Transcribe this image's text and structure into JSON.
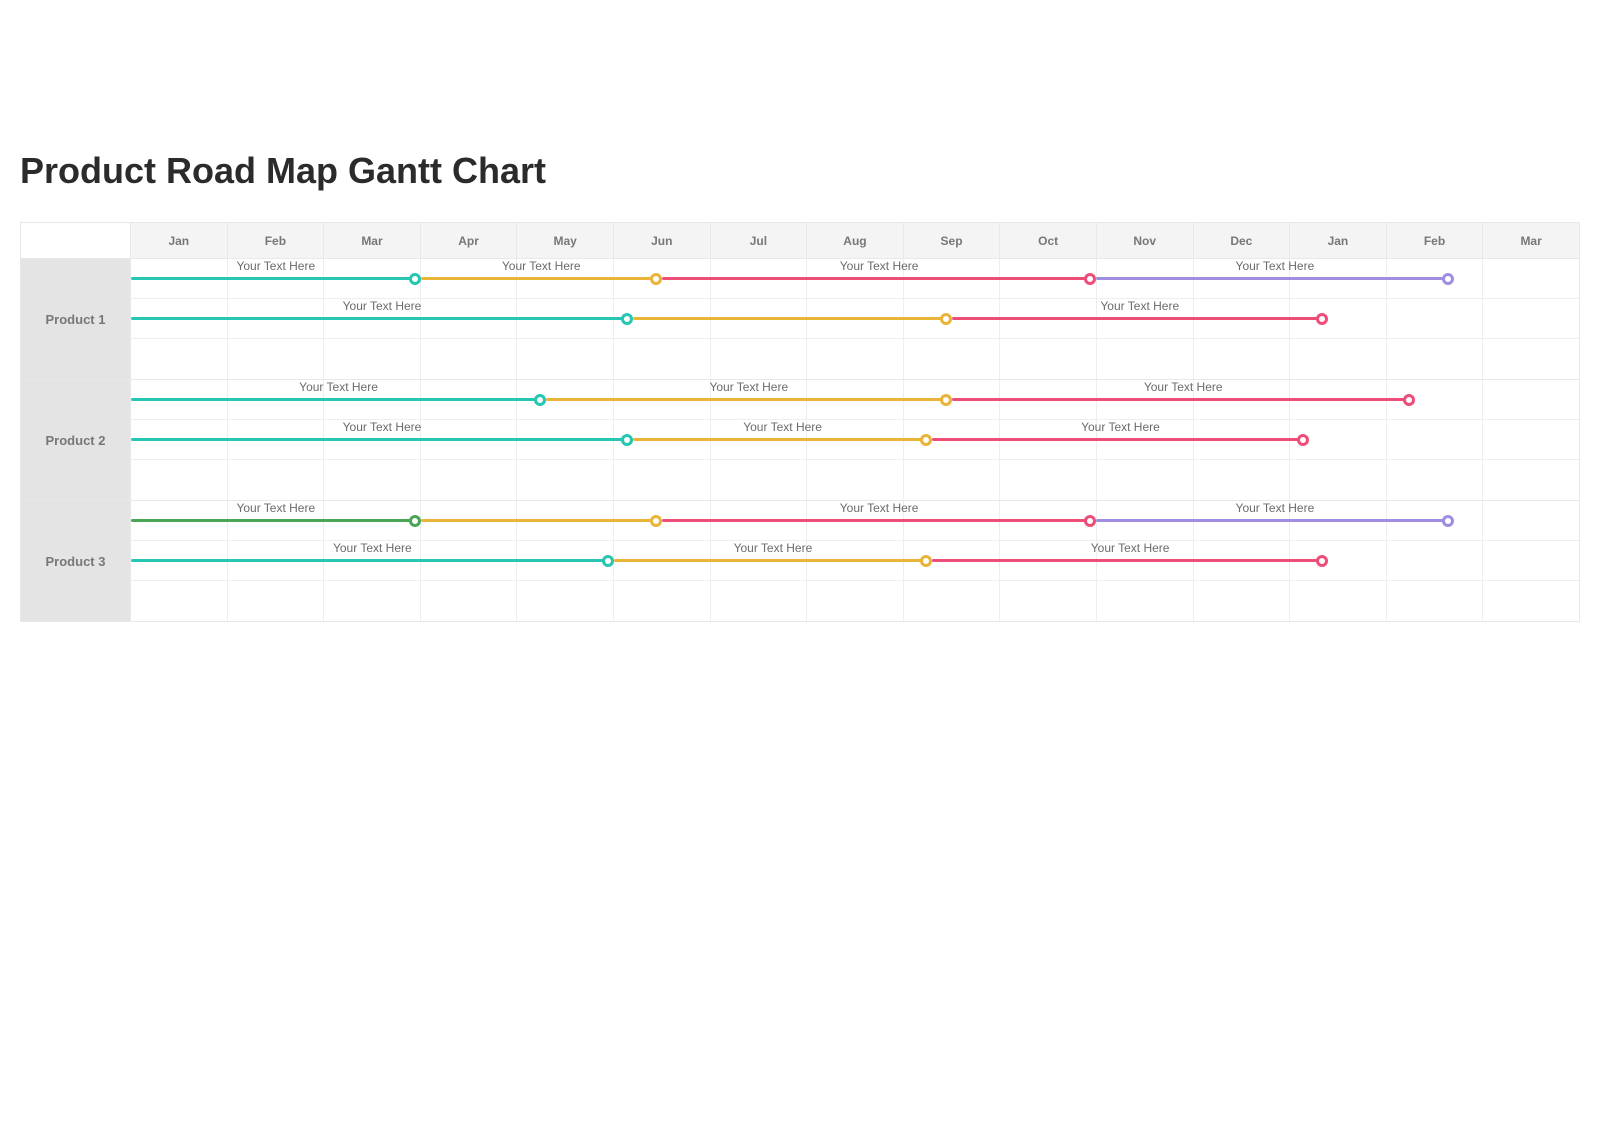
{
  "title": "Product Road Map Gantt Chart",
  "months": [
    "Jan",
    "Feb",
    "Mar",
    "Apr",
    "May",
    "Jun",
    "Jul",
    "Aug",
    "Sep",
    "Oct",
    "Nov",
    "Dec",
    "Jan",
    "Feb",
    "Mar"
  ],
  "products": [
    {
      "label": "Product 1"
    },
    {
      "label": "Product 2"
    },
    {
      "label": "Product 3"
    }
  ],
  "colors": {
    "teal": "#26c6b3",
    "green": "#4aa657",
    "amber": "#e9b438",
    "pink": "#ee4d78",
    "violet": "#a18de0"
  },
  "placeholder": "Your Text Here",
  "chart_data": {
    "type": "gantt-timeline",
    "time_axis": {
      "unit": "month",
      "labels": [
        "Jan",
        "Feb",
        "Mar",
        "Apr",
        "May",
        "Jun",
        "Jul",
        "Aug",
        "Sep",
        "Oct",
        "Nov",
        "Dec",
        "Jan",
        "Feb",
        "Mar"
      ],
      "n_cols": 15
    },
    "rows": [
      {
        "product": "Product 1",
        "tracks": [
          {
            "segments": [
              {
                "start": 0.0,
                "end": 3.0,
                "color": "teal",
                "label": "Your Text Here"
              },
              {
                "start": 3.0,
                "end": 5.5,
                "color": "amber",
                "label": "Your Text Here"
              },
              {
                "start": 5.5,
                "end": 10.0,
                "color": "pink",
                "label": "Your Text Here"
              },
              {
                "start": 10.0,
                "end": 13.7,
                "color": "violet",
                "label": "Your Text Here"
              }
            ]
          },
          {
            "segments": [
              {
                "start": 0.0,
                "end": 5.2,
                "color": "teal",
                "label": "Your Text Here"
              },
              {
                "start": 5.2,
                "end": 8.5,
                "color": "amber",
                "label": ""
              },
              {
                "start": 8.5,
                "end": 12.4,
                "color": "pink",
                "label": "Your Text Here"
              }
            ]
          },
          {
            "segments": []
          }
        ]
      },
      {
        "product": "Product 2",
        "tracks": [
          {
            "segments": [
              {
                "start": 0.0,
                "end": 4.3,
                "color": "teal",
                "label": "Your Text Here"
              },
              {
                "start": 4.3,
                "end": 8.5,
                "color": "amber",
                "label": "Your Text Here"
              },
              {
                "start": 8.5,
                "end": 13.3,
                "color": "pink",
                "label": "Your Text Here"
              }
            ]
          },
          {
            "segments": [
              {
                "start": 0.0,
                "end": 5.2,
                "color": "teal",
                "label": "Your Text Here"
              },
              {
                "start": 5.2,
                "end": 8.3,
                "color": "amber",
                "label": "Your Text Here"
              },
              {
                "start": 8.3,
                "end": 12.2,
                "color": "pink",
                "label": "Your Text Here"
              }
            ]
          },
          {
            "segments": []
          }
        ]
      },
      {
        "product": "Product 3",
        "tracks": [
          {
            "segments": [
              {
                "start": 0.0,
                "end": 3.0,
                "color": "green",
                "label": "Your Text Here"
              },
              {
                "start": 3.0,
                "end": 5.5,
                "color": "amber",
                "label": ""
              },
              {
                "start": 5.5,
                "end": 10.0,
                "color": "pink",
                "label": "Your Text Here"
              },
              {
                "start": 10.0,
                "end": 13.7,
                "color": "violet",
                "label": "Your Text Here"
              }
            ]
          },
          {
            "segments": [
              {
                "start": 0.0,
                "end": 5.0,
                "color": "teal",
                "label": "Your Text Here"
              },
              {
                "start": 5.0,
                "end": 8.3,
                "color": "amber",
                "label": "Your Text Here"
              },
              {
                "start": 8.3,
                "end": 12.4,
                "color": "pink",
                "label": "Your Text Here"
              }
            ]
          },
          {
            "segments": []
          }
        ]
      }
    ]
  }
}
